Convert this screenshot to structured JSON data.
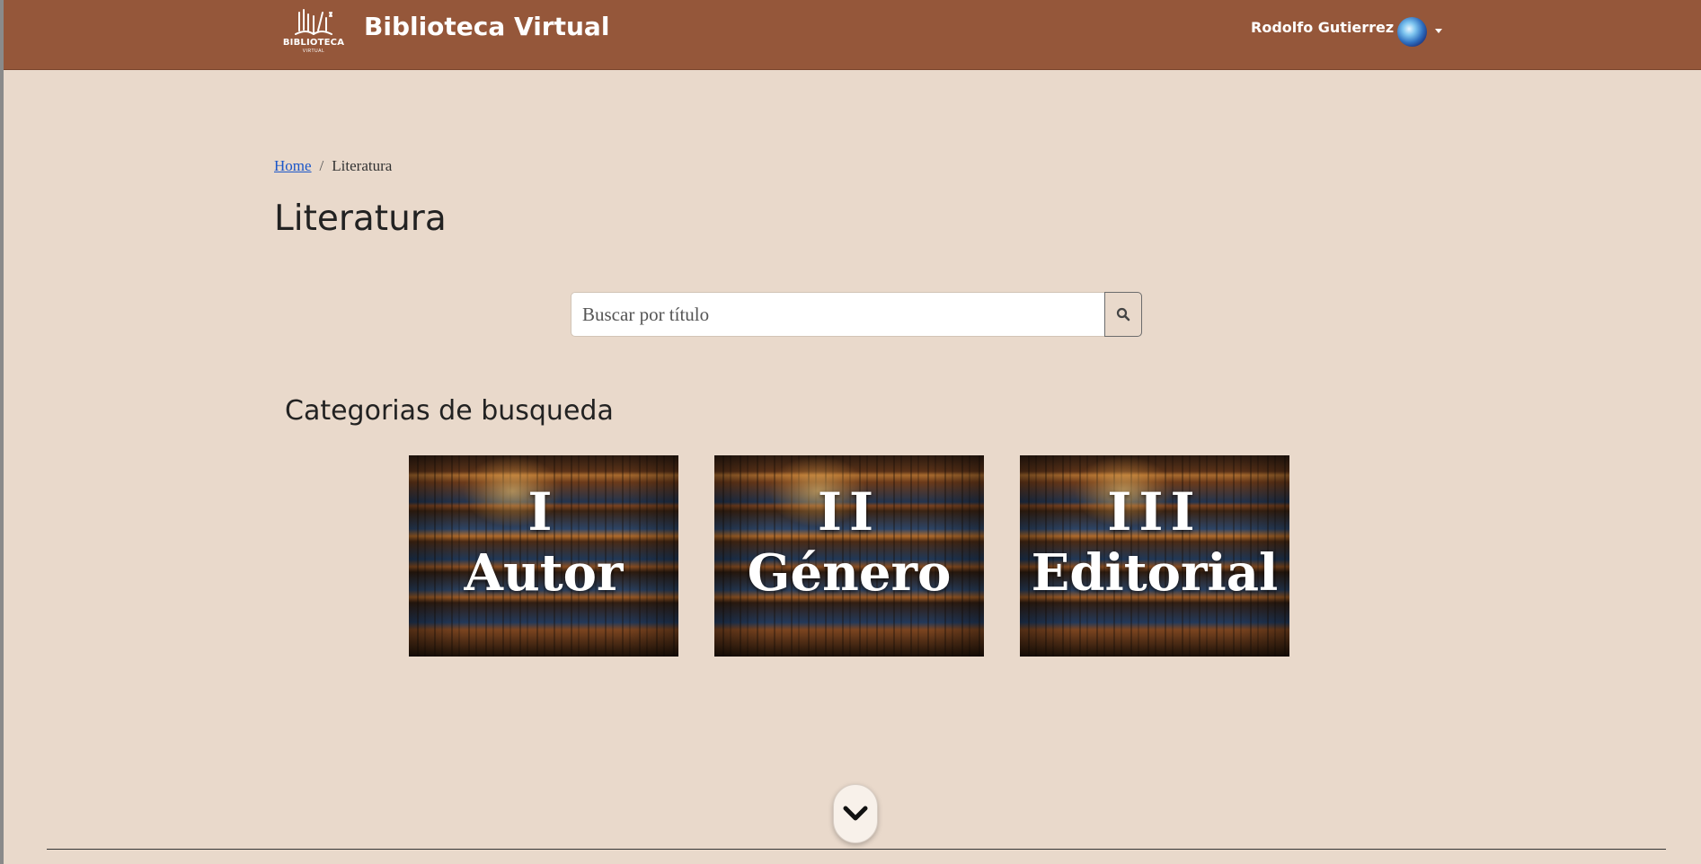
{
  "navbar": {
    "logo_text": "BIBLIOTECA",
    "logo_subtext": "VIRTUAL",
    "brand": "Biblioteca Virtual",
    "user_name": "Rodolfo Gutierrez",
    "accent_color": "#95573a"
  },
  "breadcrumb": {
    "home": "Home",
    "separator": "/",
    "current": "Literatura"
  },
  "page": {
    "title": "Literatura",
    "background_color": "#e9d9cb"
  },
  "search": {
    "placeholder": "Buscar por título",
    "value": "",
    "button_icon": "search-icon"
  },
  "categories": {
    "title": "Categorias de busqueda",
    "items": [
      {
        "numeral": "I",
        "label": "Autor"
      },
      {
        "numeral": "II",
        "label": "Género"
      },
      {
        "numeral": "III",
        "label": "Editorial"
      }
    ]
  },
  "scroll_button": {
    "icon": "chevron-down-icon"
  }
}
